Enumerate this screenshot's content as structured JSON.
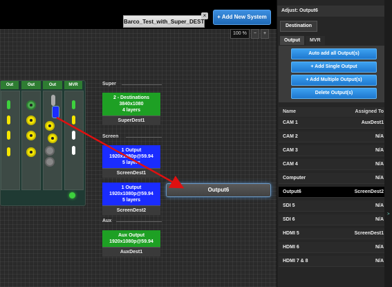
{
  "toolbar": {
    "tab_label": "Barco_Test_with_Super_DEST",
    "tab_close": "×",
    "add_system": "+ Add New System",
    "zoom_value": "100 %",
    "zoom_out": "−",
    "zoom_in": "+"
  },
  "device": {
    "columns": [
      "Out",
      "Out",
      "Out",
      "MVR"
    ]
  },
  "groups": {
    "super": "Super",
    "screen": "Screen",
    "aux": "Aux"
  },
  "destinations": {
    "super": {
      "line1": "2 - Destinations",
      "line2": "3840x1080",
      "line3": "4 layers",
      "name": "SuperDest1"
    },
    "screen1": {
      "line1": "1 Output",
      "line2": "1920x1080p@59.94",
      "line3": "5 layers",
      "name": "ScreenDest1"
    },
    "screen2": {
      "line1": "1 Output",
      "line2": "1920x1080p@59.94",
      "line3": "5 layers",
      "name": "ScreenDest2"
    },
    "aux": {
      "line1": "Aux Output",
      "line2": "1920x1080p@59.94",
      "name": "AuxDest1"
    }
  },
  "output_node": "Output6",
  "panel": {
    "header": "Adjust: Output6",
    "dest_tab": "Destination",
    "subtabs": [
      "Output",
      "MVR"
    ],
    "actions": [
      "Auto add all Output(s)",
      "+ Add Single Output",
      "+ Add Multiple Output(s)",
      "Delete Output(s)"
    ],
    "list_headers": {
      "name": "Name",
      "assigned": "Assigned To"
    },
    "rows": [
      {
        "name": "CAM 1",
        "assigned": "AuxDest1"
      },
      {
        "name": "CAM 2",
        "assigned": "N/A"
      },
      {
        "name": "CAM 3",
        "assigned": "N/A"
      },
      {
        "name": "CAM 4",
        "assigned": "N/A"
      },
      {
        "name": "Computer",
        "assigned": "N/A"
      },
      {
        "name": "Output6",
        "assigned": "ScreenDest2"
      },
      {
        "name": "SDI 5",
        "assigned": "N/A"
      },
      {
        "name": "SDI 6",
        "assigned": "N/A"
      },
      {
        "name": "HDMI 5",
        "assigned": "ScreenDest1"
      },
      {
        "name": "HDMI 6",
        "assigned": "N/A"
      },
      {
        "name": "HDMI 7 & 8",
        "assigned": "N/A"
      }
    ],
    "selected_row": "Output6"
  },
  "colors": {
    "accent_blue": "#1e78cf",
    "dest_green": "#1ea024",
    "dest_blue": "#1a2cff",
    "wire_red": "#e01010"
  }
}
